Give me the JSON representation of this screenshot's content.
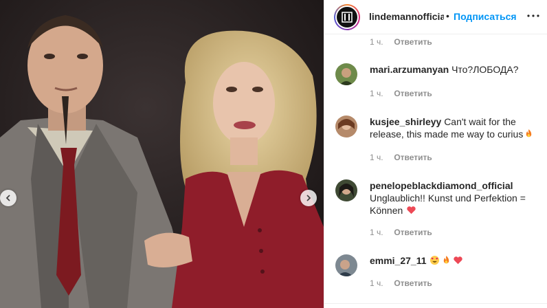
{
  "post": {
    "account": "lindemannofficial",
    "separator": "•",
    "follow_label": "Подписаться"
  },
  "comments": [
    {
      "user": "mari.arzumanyan",
      "text": "Что?ЛОБОДА?",
      "emojis": [],
      "time": "1 ч.",
      "reply": "Ответить"
    },
    {
      "user": "kusjee_shirleyy",
      "text": "Can't wait for the release, this made me way to curius",
      "emojis": [
        "fire-emoji"
      ],
      "time": "1 ч.",
      "reply": "Ответить"
    },
    {
      "user": "penelopeblackdiamond_official",
      "text": "Unglaublich!! Kunst und Perfektion = Können",
      "emojis": [
        "red-heart-emoji"
      ],
      "time": "1 ч.",
      "reply": "Ответить"
    },
    {
      "user": "emmi_27_11",
      "text": "",
      "emojis": [
        "heart-eyes-emoji",
        "fire-emoji",
        "red-heart-emoji"
      ],
      "time": "1 ч.",
      "reply": "Ответить"
    }
  ],
  "previous_comment_meta": {
    "time": "1 ч.",
    "reply": "Ответить"
  },
  "icons": {
    "prev": "chevron-left-icon",
    "next": "chevron-right-icon",
    "more": "more-horizontal-icon"
  },
  "colors": {
    "link_blue": "#0095f6",
    "muted": "#8e8e8e",
    "heart_red": "#ed4956"
  }
}
